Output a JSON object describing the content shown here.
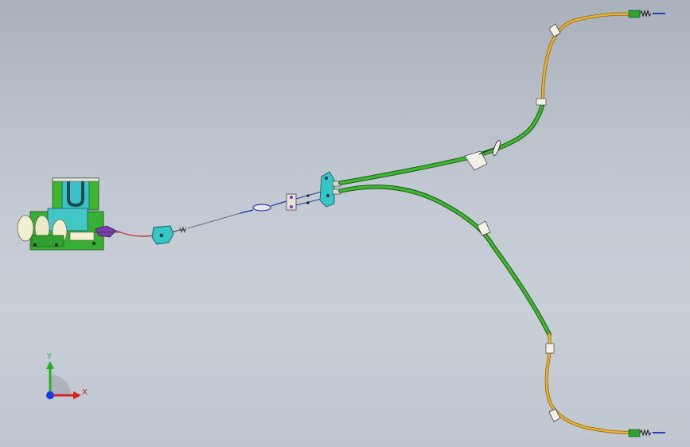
{
  "viewport": {
    "background_top": "#a9b1bc",
    "background_bottom": "#c9cfd7"
  },
  "model": {
    "parts": [
      "handbrake-lever-assembly",
      "equalizer-bracket",
      "front-cable",
      "cable-adjuster",
      "y-splitter-bracket",
      "rear-cable-left",
      "rear-cable-right",
      "cable-clips",
      "cable-end-fittings"
    ],
    "colors": {
      "cable_green": "#3fb530",
      "cable_orange": "#f0b030",
      "bracket_cyan": "#36c6c6",
      "assembly_cream": "#f2eed2",
      "fitting_blue": "#2a3fb0",
      "front_wire": "#c81e1e"
    }
  },
  "triad": {
    "x_label": "X",
    "y_label": "Y",
    "x_color": "#d82020",
    "y_color": "#22b022",
    "z_color": "#1a3ae0"
  }
}
